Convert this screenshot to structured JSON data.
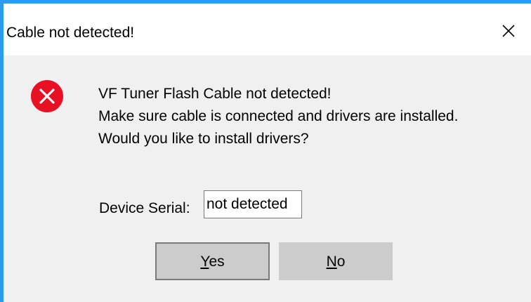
{
  "dialog": {
    "title": "Cable not detected!",
    "close_glyph": "✕",
    "icon": "error-icon",
    "message_lines": [
      "VF Tuner Flash Cable not detected!",
      "Make sure cable is connected and drivers are installed.",
      "Would you like to install drivers?"
    ],
    "serial_label": "Device Serial:",
    "serial_value": "not detected",
    "yes_mnemonic": "Y",
    "yes_rest": "es",
    "no_mnemonic": "N",
    "no_rest": "o",
    "colors": {
      "accent_border": "#2b9bf0",
      "error_red": "#e81123"
    }
  }
}
